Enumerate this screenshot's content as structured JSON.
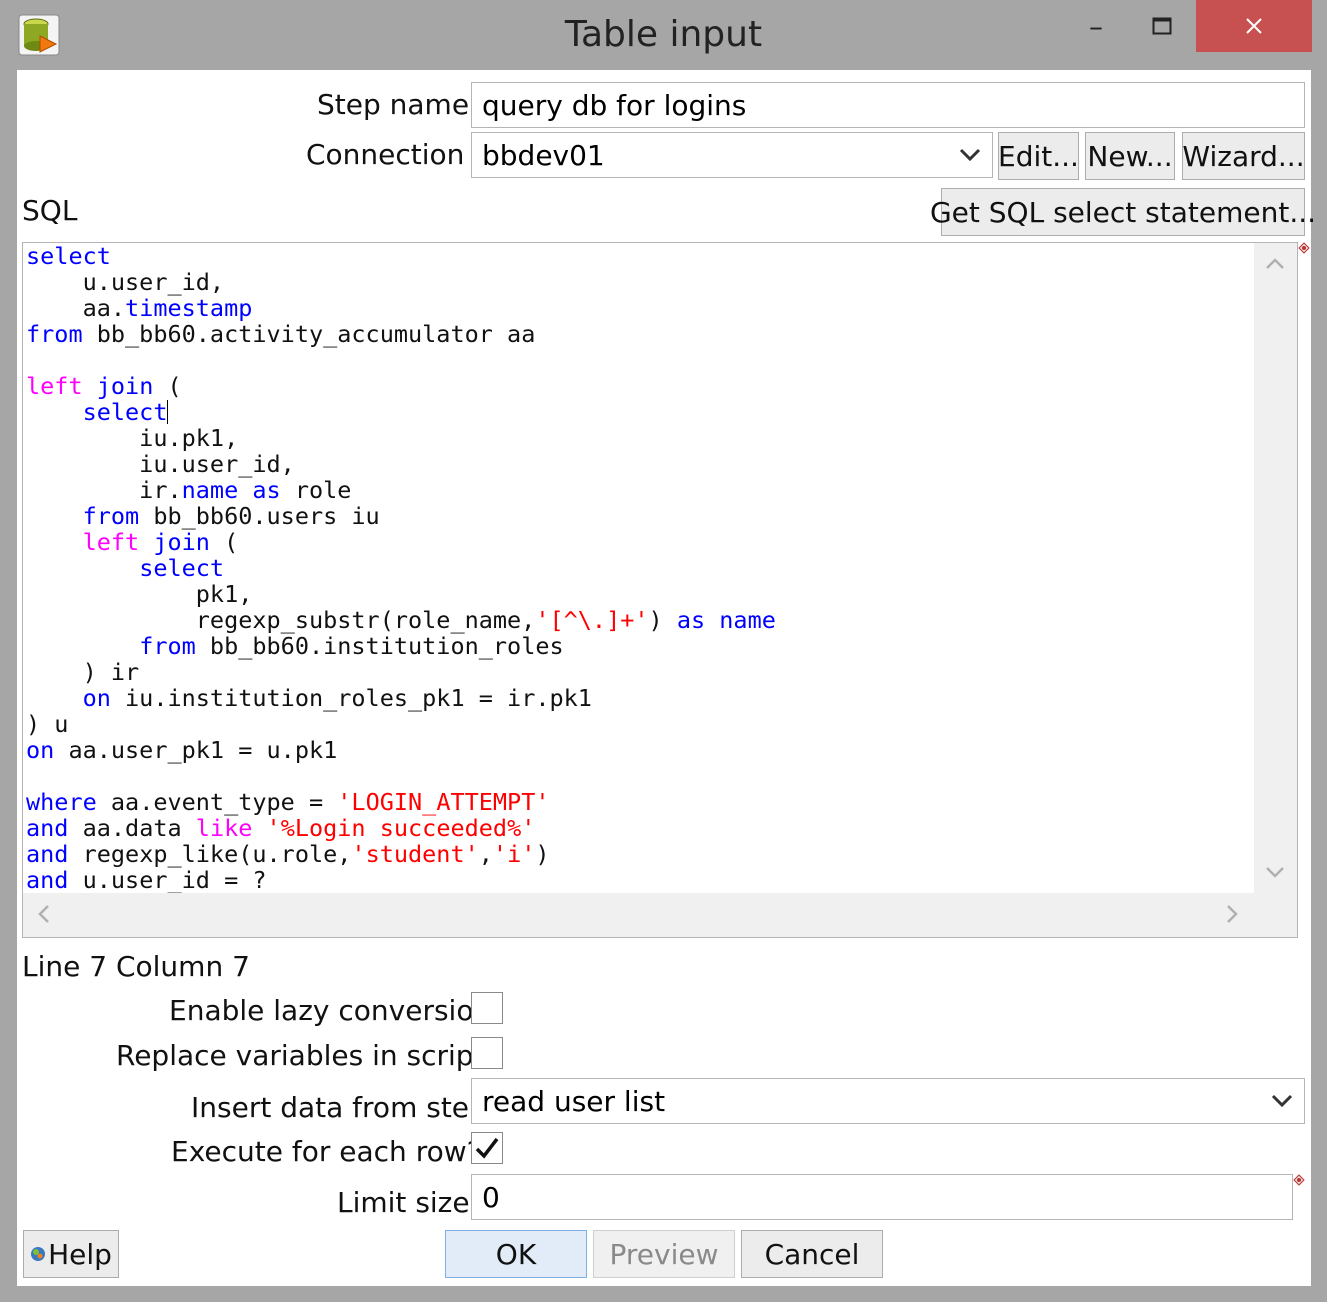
{
  "window": {
    "title": "Table input",
    "minimize_glyph": "–",
    "maximize_glyph": "☐",
    "close_glyph": "✕",
    "close_color": "#c75050"
  },
  "step_name": {
    "label": "Step name",
    "value": "query db for logins"
  },
  "connection": {
    "label": "Connection",
    "value": "bbdev01",
    "edit_label": "Edit...",
    "new_label": "New...",
    "wizard_label": "Wizard..."
  },
  "sql": {
    "label": "SQL",
    "get_sql_label": "Get SQL select statement...",
    "lines": [
      [
        {
          "t": "select",
          "c": "kw"
        }
      ],
      [
        {
          "t": "    u.user_id,",
          "c": ""
        }
      ],
      [
        {
          "t": "    aa.",
          "c": ""
        },
        {
          "t": "timestamp",
          "c": "kw"
        }
      ],
      [
        {
          "t": "from",
          "c": "kw"
        },
        {
          "t": " bb_bb60.activity_accumulator aa",
          "c": ""
        }
      ],
      [
        {
          "t": "",
          "c": ""
        }
      ],
      [
        {
          "t": "left",
          "c": "kw2"
        },
        {
          "t": " ",
          "c": ""
        },
        {
          "t": "join",
          "c": "kw"
        },
        {
          "t": " (",
          "c": ""
        }
      ],
      [
        {
          "t": "    ",
          "c": ""
        },
        {
          "t": "select",
          "c": "kw"
        },
        {
          "t": "",
          "c": "caret"
        }
      ],
      [
        {
          "t": "        iu.pk1,",
          "c": ""
        }
      ],
      [
        {
          "t": "        iu.user_id,",
          "c": ""
        }
      ],
      [
        {
          "t": "        ir.",
          "c": ""
        },
        {
          "t": "name",
          "c": "kw"
        },
        {
          "t": " ",
          "c": ""
        },
        {
          "t": "as",
          "c": "kw"
        },
        {
          "t": " role",
          "c": ""
        }
      ],
      [
        {
          "t": "    ",
          "c": ""
        },
        {
          "t": "from",
          "c": "kw"
        },
        {
          "t": " bb_bb60.users iu",
          "c": ""
        }
      ],
      [
        {
          "t": "    ",
          "c": ""
        },
        {
          "t": "left",
          "c": "kw2"
        },
        {
          "t": " ",
          "c": ""
        },
        {
          "t": "join",
          "c": "kw"
        },
        {
          "t": " (",
          "c": ""
        }
      ],
      [
        {
          "t": "        ",
          "c": ""
        },
        {
          "t": "select",
          "c": "kw"
        }
      ],
      [
        {
          "t": "            pk1,",
          "c": ""
        }
      ],
      [
        {
          "t": "            regexp_substr(role_name,",
          "c": ""
        },
        {
          "t": "'[^\\.]+'",
          "c": "str"
        },
        {
          "t": ") ",
          "c": ""
        },
        {
          "t": "as",
          "c": "kw"
        },
        {
          "t": " ",
          "c": ""
        },
        {
          "t": "name",
          "c": "kw"
        }
      ],
      [
        {
          "t": "        ",
          "c": ""
        },
        {
          "t": "from",
          "c": "kw"
        },
        {
          "t": " bb_bb60.institution_roles",
          "c": ""
        }
      ],
      [
        {
          "t": "    ) ir",
          "c": ""
        }
      ],
      [
        {
          "t": "    ",
          "c": ""
        },
        {
          "t": "on",
          "c": "kw"
        },
        {
          "t": " iu.institution_roles_pk1 = ir.pk1",
          "c": ""
        }
      ],
      [
        {
          "t": ") u",
          "c": ""
        }
      ],
      [
        {
          "t": "on",
          "c": "kw"
        },
        {
          "t": " aa.user_pk1 = u.pk1",
          "c": ""
        }
      ],
      [
        {
          "t": "",
          "c": ""
        }
      ],
      [
        {
          "t": "where",
          "c": "kw"
        },
        {
          "t": " aa.event_type = ",
          "c": ""
        },
        {
          "t": "'LOGIN_ATTEMPT'",
          "c": "str"
        }
      ],
      [
        {
          "t": "and",
          "c": "kw"
        },
        {
          "t": " aa.data ",
          "c": ""
        },
        {
          "t": "like",
          "c": "kw2"
        },
        {
          "t": " ",
          "c": ""
        },
        {
          "t": "'%Login succeeded%'",
          "c": "str"
        }
      ],
      [
        {
          "t": "and",
          "c": "kw"
        },
        {
          "t": " regexp_like(u.role,",
          "c": ""
        },
        {
          "t": "'student'",
          "c": "str"
        },
        {
          "t": ",",
          "c": ""
        },
        {
          "t": "'i'",
          "c": "str"
        },
        {
          "t": ")",
          "c": ""
        }
      ],
      [
        {
          "t": "and",
          "c": "kw"
        },
        {
          "t": " u.user_id = ?",
          "c": ""
        }
      ]
    ],
    "colors": {
      "keyword": "#0000ff",
      "keyword2": "#ff00ff",
      "string": "#ff0000"
    }
  },
  "status": {
    "position_text": "Line 7 Column 7"
  },
  "options": {
    "lazy_conversion": {
      "label": "Enable lazy conversion",
      "checked": false
    },
    "replace_variables": {
      "label": "Replace variables in script?",
      "checked": false
    },
    "insert_data": {
      "label": "Insert data from step",
      "value": "read user list"
    },
    "execute_each_row": {
      "label": "Execute for each row?",
      "checked": true
    },
    "limit_size": {
      "label": "Limit size",
      "value": "0"
    }
  },
  "buttons": {
    "help_label": "Help",
    "ok_label": "OK",
    "preview_label": "Preview",
    "cancel_label": "Cancel"
  }
}
